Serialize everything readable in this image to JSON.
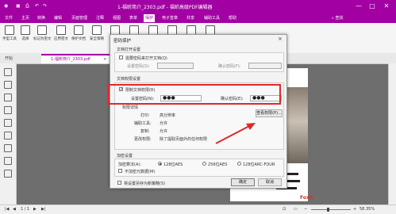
{
  "titlebar": {
    "doc_title": "1-福昕简介_2303.pdf - 福昕高级PDF编辑器",
    "minimize": "—",
    "maximize": "□",
    "close": "✕"
  },
  "menubar": {
    "items": [
      "文件",
      "主页",
      "转换",
      "编辑",
      "页面管理",
      "注释",
      "视图",
      "表单",
      "保护",
      "电子签章",
      "共享",
      "辅助工具",
      "帮助"
    ],
    "active_index": 8,
    "find_label": "查找"
  },
  "ribbon": {
    "buttons": [
      "手型工具",
      "选择",
      "标记为密文",
      "应用密文",
      "保护文档",
      "安全策略",
      "签名",
      "放置签名",
      "验证签名",
      "数字身份",
      "时间戳",
      "证书"
    ]
  },
  "tabbar": {
    "start_label": "开始",
    "doc_tab_label": "1-福昕简介_2303.pdf",
    "doc_tab_close": "×"
  },
  "page": {
    "brand": "Foxit"
  },
  "statusbar": {
    "page_indicator": "1 / 1",
    "zoom": "58.35%"
  },
  "dialog": {
    "title": "密码保护",
    "close": "×",
    "open_section": "文档打开设置",
    "require_open_pw_label": "需要密码来打开文档(Q)",
    "open_pw_label": "设置密码(S):",
    "open_confirm_label": "确认密码(F):",
    "perm_section": "文档权限设置",
    "restrict_label": "限制文档权限(R)",
    "restrict_checked": true,
    "perm_pw_label": "设置密码(N):",
    "perm_pw_value": "●●●",
    "perm_confirm_label": "确认密码(E):",
    "perm_confirm_value": "●●●",
    "perm_detail_title": "权限详情",
    "perm_rows": [
      {
        "label": "打印:",
        "value": "高分辨率"
      },
      {
        "label": "辅助工具:",
        "value": "允许"
      },
      {
        "label": "复制:",
        "value": "允许"
      },
      {
        "label": "更改权限:",
        "value": "除了提取页面外的任何权限"
      }
    ],
    "view_perm_button": "查看权限(P)...",
    "encrypt_section": "加密设置",
    "algorithm_label": "加密算法(A):",
    "algorithms": [
      "128位AES",
      "256位AES",
      "128位ARC-FOUR"
    ],
    "selected_algorithm": 0,
    "no_meta_label": "不加密元数据(M)",
    "save_policy_label": "将设置另存为新策略(S)",
    "ok_button": "确定",
    "cancel_button": "取消"
  }
}
